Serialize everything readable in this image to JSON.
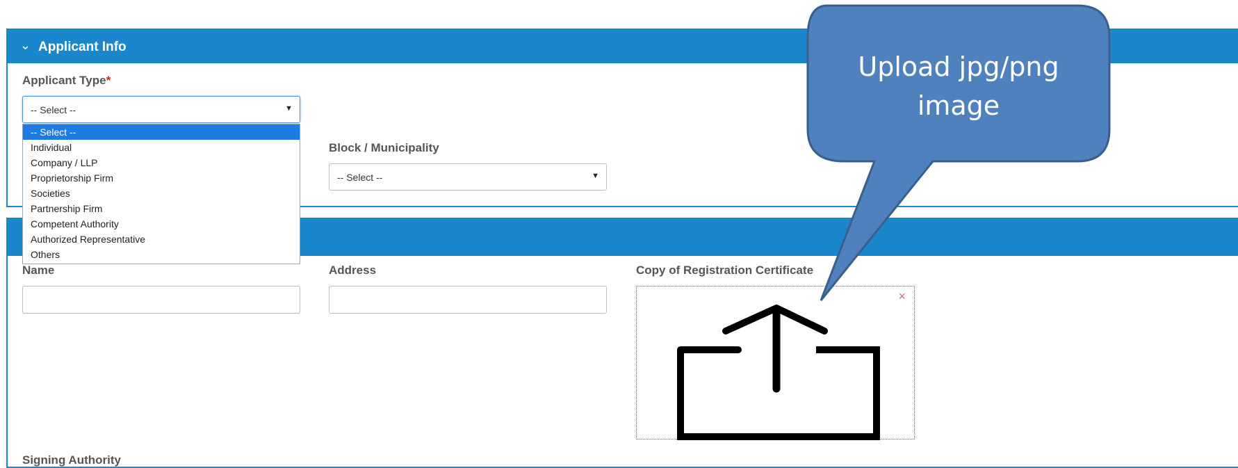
{
  "applicant_section": {
    "title": "Applicant Info",
    "applicant_type_label": "Applicant Type",
    "required_mark": "*",
    "applicant_type_value": "-- Select --",
    "block_label": "Block / Municipality",
    "block_value": "-- Select --"
  },
  "dropdown": {
    "options": [
      "-- Select --",
      "Individual",
      "Company / LLP",
      "Proprietorship Firm",
      "Societies",
      "Partnership Firm",
      "Competent Authority",
      "Authorized Representative",
      "Others"
    ],
    "selected_index": 0
  },
  "details_section": {
    "name_label": "Name",
    "name_value": "",
    "address_label": "Address",
    "address_value": "",
    "certificate_label": "Copy of Registration Certificate",
    "close_symbol": "×",
    "signing_label": "Signing Authority"
  },
  "callout": {
    "line1": "Upload jpg/png",
    "line2": "image"
  },
  "icons": {
    "chevron": "chevron-down-icon",
    "upload": "upload-icon",
    "close": "close-icon"
  },
  "colors": {
    "header_blue": "#1a87cd",
    "selected_blue": "#1e7be3",
    "callout_fill": "#4e81bd",
    "callout_border": "#3a5f8d",
    "required_red": "#e0201f"
  }
}
